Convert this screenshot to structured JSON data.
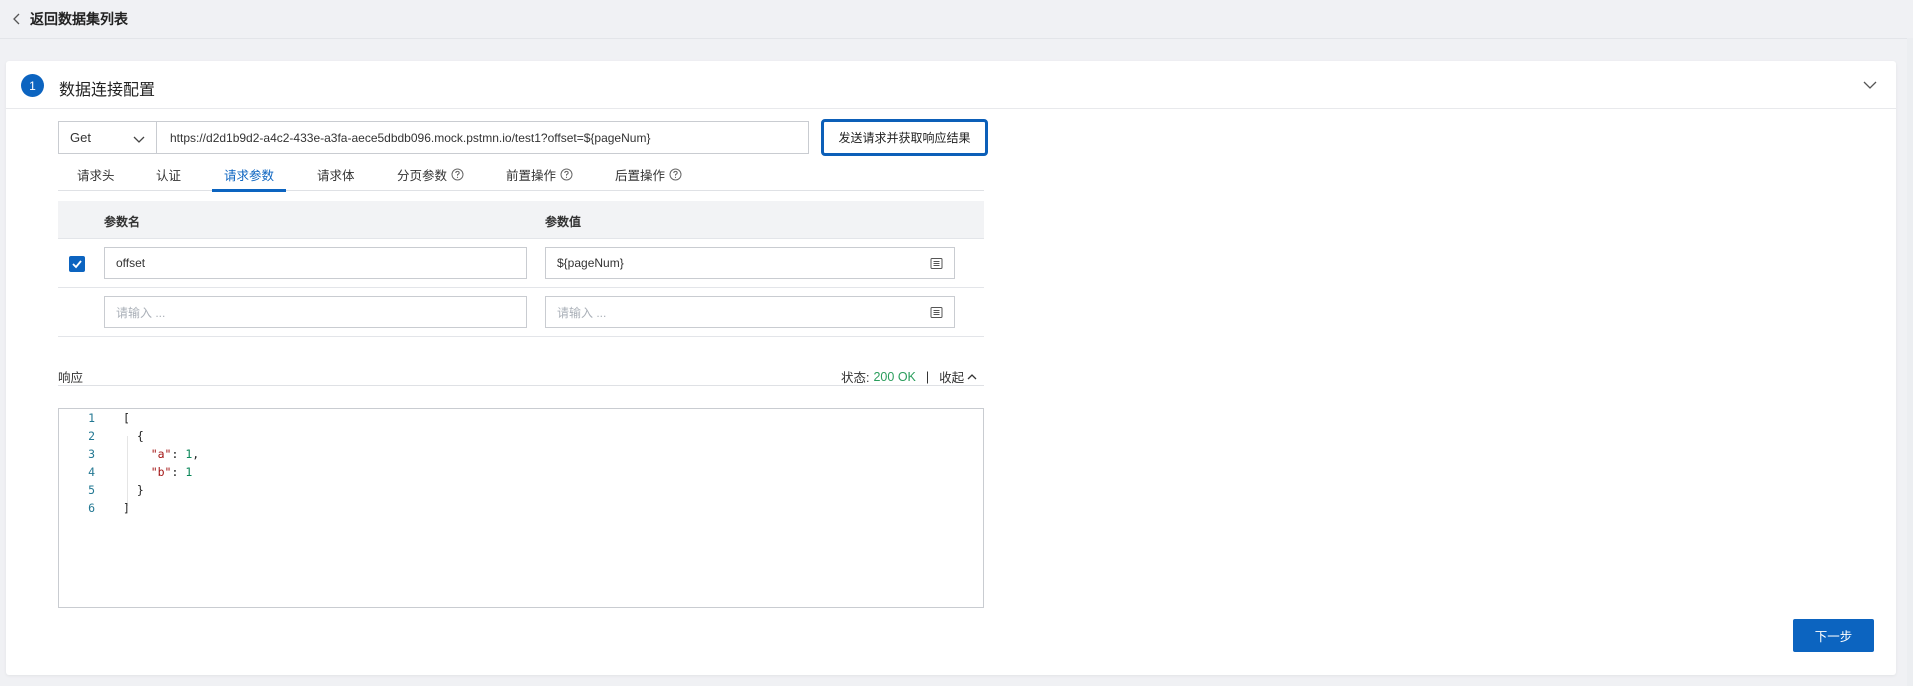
{
  "nav": {
    "back_label": "返回数据集列表"
  },
  "step": {
    "number": "1",
    "title": "数据连接配置"
  },
  "request": {
    "method": "Get",
    "url": "https://d2d1b9d2-a4c2-433e-a3fa-aece5dbdb096.mock.pstmn.io/test1?offset=${pageNum}",
    "send_label": "发送请求并获取响应结果"
  },
  "tabs": [
    {
      "label": "请求头",
      "help": false
    },
    {
      "label": "认证",
      "help": false
    },
    {
      "label": "请求参数",
      "help": false,
      "active": true
    },
    {
      "label": "请求体",
      "help": false
    },
    {
      "label": "分页参数",
      "help": true
    },
    {
      "label": "前置操作",
      "help": true
    },
    {
      "label": "后置操作",
      "help": true
    }
  ],
  "params": {
    "col_name": "参数名",
    "col_value": "参数值",
    "rows": [
      {
        "checked": true,
        "name": "offset",
        "value": "${pageNum}"
      }
    ],
    "empty_row": {
      "name_placeholder": "请输入 ...",
      "value_placeholder": "请输入 ..."
    }
  },
  "response": {
    "label": "响应",
    "status_label": "状态:",
    "status_value": "200 OK",
    "separator": "|",
    "collapse_label": "收起",
    "lines": [
      "1",
      "2",
      "3",
      "4",
      "5",
      "6"
    ]
  },
  "footer": {
    "next_label": "下一步"
  },
  "colors": {
    "primary": "#0c64c0",
    "ok": "#2a9d5c"
  }
}
